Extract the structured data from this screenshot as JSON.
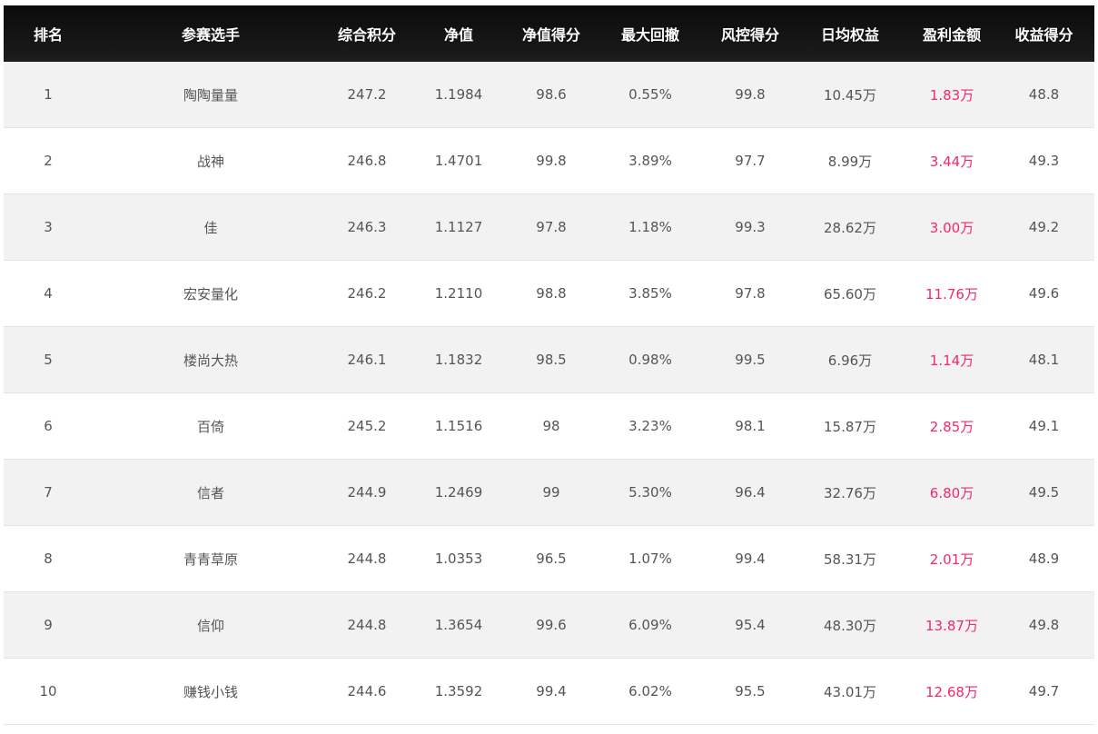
{
  "headers": [
    "排名",
    "参赛选手",
    "综合积分",
    "净值",
    "净值得分",
    "最大回撤",
    "风控得分",
    "日均权益",
    "盈利金额",
    "收益得分"
  ],
  "rows": [
    [
      "1",
      "陶陶量量",
      "247.2",
      "1.1984",
      "98.6",
      "0.55%",
      "99.8",
      "10.45万",
      "1.83万",
      "48.8"
    ],
    [
      "2",
      "战神",
      "246.8",
      "1.4701",
      "99.8",
      "3.89%",
      "97.7",
      "8.99万",
      "3.44万",
      "49.3"
    ],
    [
      "3",
      "佳",
      "246.3",
      "1.1127",
      "97.8",
      "1.18%",
      "99.3",
      "28.62万",
      "3.00万",
      "49.2"
    ],
    [
      "4",
      "宏安量化",
      "246.2",
      "1.2110",
      "98.8",
      "3.85%",
      "97.8",
      "65.60万",
      "11.76万",
      "49.6"
    ],
    [
      "5",
      "楼尚大热",
      "246.1",
      "1.1832",
      "98.5",
      "0.98%",
      "99.5",
      "6.96万",
      "1.14万",
      "48.1"
    ],
    [
      "6",
      "百倚",
      "245.2",
      "1.1516",
      "98",
      "3.23%",
      "98.1",
      "15.87万",
      "2.85万",
      "49.1"
    ],
    [
      "7",
      "信者",
      "244.9",
      "1.2469",
      "99",
      "5.30%",
      "96.4",
      "32.76万",
      "6.80万",
      "49.5"
    ],
    [
      "8",
      "青青草原",
      "244.8",
      "1.0353",
      "96.5",
      "1.07%",
      "99.4",
      "58.31万",
      "2.01万",
      "48.9"
    ],
    [
      "9",
      "信仰",
      "244.8",
      "1.3654",
      "99.6",
      "6.09%",
      "95.4",
      "48.30万",
      "13.87万",
      "49.8"
    ],
    [
      "10",
      "赚钱小钱",
      "244.6",
      "1.3592",
      "99.4",
      "6.02%",
      "95.5",
      "43.01万",
      "12.68万",
      "49.7"
    ]
  ],
  "colors": {
    "header_bg": "#111111",
    "profit_text": "#ef2a6b",
    "stripe_bg": "#f2f2f2"
  }
}
